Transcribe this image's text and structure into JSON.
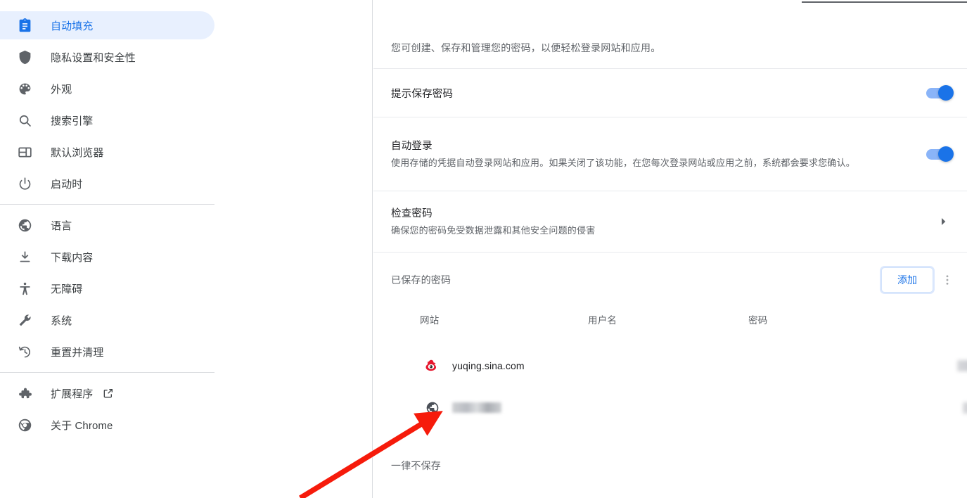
{
  "sidebar": {
    "items": [
      {
        "label": "自动填充",
        "icon": "clipboard-icon",
        "selected": true
      },
      {
        "label": "隐私设置和安全性",
        "icon": "shield-icon",
        "selected": false
      },
      {
        "label": "外观",
        "icon": "palette-icon",
        "selected": false
      },
      {
        "label": "搜索引擎",
        "icon": "search-icon",
        "selected": false
      },
      {
        "label": "默认浏览器",
        "icon": "browser-window-icon",
        "selected": false
      },
      {
        "label": "启动时",
        "icon": "power-icon",
        "selected": false
      },
      {
        "label": "语言",
        "icon": "globe-icon",
        "selected": false
      },
      {
        "label": "下载内容",
        "icon": "download-icon",
        "selected": false
      },
      {
        "label": "无障碍",
        "icon": "accessibility-icon",
        "selected": false
      },
      {
        "label": "系统",
        "icon": "wrench-icon",
        "selected": false
      },
      {
        "label": "重置并清理",
        "icon": "restore-history-icon",
        "selected": false
      },
      {
        "label": "扩展程序",
        "icon": "puzzle-icon",
        "selected": false,
        "external": true
      },
      {
        "label": "关于 Chrome",
        "icon": "chrome-icon",
        "selected": false
      }
    ]
  },
  "main": {
    "intro": "您可创建、保存和管理您的密码，以便轻松登录网站和应用。",
    "settings": [
      {
        "title": "提示保存密码",
        "sub": "",
        "control": "toggle",
        "toggle_on": true
      },
      {
        "title": "自动登录",
        "sub": "使用存储的凭据自动登录网站和应用。如果关闭了该功能，在您每次登录网站或应用之前，系统都会要求您确认。",
        "control": "toggle",
        "toggle_on": true
      },
      {
        "title": "检查密码",
        "sub": "确保您的密码免受数据泄露和其他安全问题的侵害",
        "control": "chevron",
        "toggle_on": false
      }
    ],
    "saved_passwords": {
      "section_title": "已保存的密码",
      "add_label": "添加",
      "overflow_label": "更多操作",
      "columns": [
        "网站",
        "用户名",
        "密码"
      ],
      "rows": [
        {
          "site": "yuqing.sina.com",
          "site_redacted": false,
          "favicon": "sina-weibo-icon",
          "username": "",
          "username_redacted": true,
          "password": "",
          "password_redacted": true
        },
        {
          "site": "",
          "site_redacted": true,
          "favicon": "globe-icon",
          "username": "",
          "username_redacted": true,
          "password": "",
          "password_redacted": true
        }
      ]
    },
    "never_saved_label": "一律不保存"
  },
  "annotation": {
    "type": "red-arrow",
    "color": "#f61b0b"
  },
  "colors": {
    "accent": "#1a73e8",
    "selected_bg": "#e8f0fe",
    "toggle_track": "#8ab4f8",
    "text_primary": "#202124",
    "text_secondary": "#5f6368",
    "divider": "#dadce0"
  }
}
